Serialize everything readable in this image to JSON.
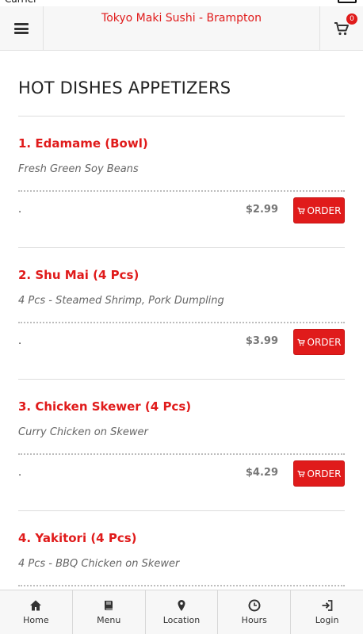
{
  "header": {
    "title": "Tokyo Maki Sushi - Brampton",
    "menu_icon": "hamburger-icon",
    "cart_icon": "cart-icon",
    "cart_count": "0"
  },
  "section": {
    "title": "HOT DISHES APPETIZERS"
  },
  "items": [
    {
      "name": "1. Edamame (Bowl)",
      "desc": "Fresh Green Soy Beans",
      "bullet": ".",
      "price": "$2.99",
      "order_label": "ORDER"
    },
    {
      "name": "2. Shu Mai (4 Pcs)",
      "desc": "4 Pcs - Steamed Shrimp, Pork Dumpling",
      "bullet": ".",
      "price": "$3.99",
      "order_label": "ORDER"
    },
    {
      "name": "3. Chicken Skewer (4 Pcs)",
      "desc": "Curry Chicken on Skewer",
      "bullet": ".",
      "price": "$4.29",
      "order_label": "ORDER"
    },
    {
      "name": "4. Yakitori (4 Pcs)",
      "desc": "4 Pcs - BBQ Chicken on Skewer",
      "bullet": "",
      "price": "",
      "order_label": ""
    }
  ],
  "bottom_nav": [
    {
      "label": "Home",
      "icon": "home-icon"
    },
    {
      "label": "Menu",
      "icon": "book-icon"
    },
    {
      "label": "Location",
      "icon": "map-marker-icon"
    },
    {
      "label": "Hours",
      "icon": "clock-icon"
    },
    {
      "label": "Login",
      "icon": "sign-in-icon"
    }
  ],
  "colors": {
    "accent": "#e01b1b",
    "header_bg": "#f7f7f7",
    "price": "#777777"
  }
}
